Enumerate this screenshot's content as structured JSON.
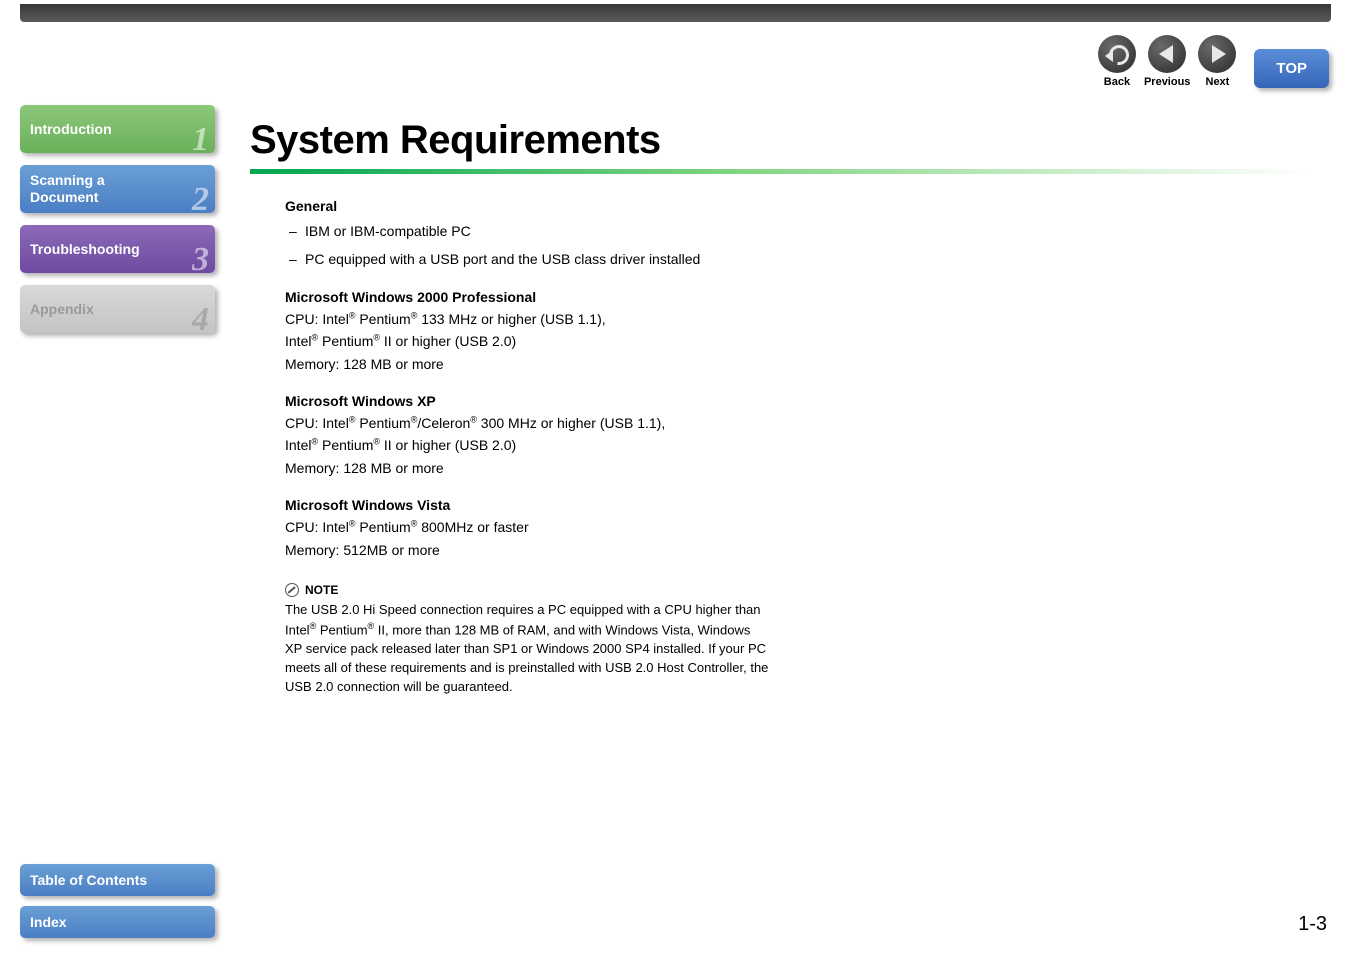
{
  "nav": {
    "back": "Back",
    "previous": "Previous",
    "next": "Next",
    "top": "TOP"
  },
  "tabs": [
    {
      "label": "Introduction",
      "number": "1"
    },
    {
      "label": "Scanning a\nDocument",
      "number": "2"
    },
    {
      "label": "Troubleshooting",
      "number": "3"
    },
    {
      "label": "Appendix",
      "number": "4"
    }
  ],
  "bottom_nav": {
    "toc": "Table of Contents",
    "index": "Index"
  },
  "page": {
    "title": "System Requirements",
    "general_heading": "General",
    "general_items": [
      "IBM or IBM-compatible PC",
      "PC equipped with a USB port and the USB class driver installed"
    ],
    "win2000": {
      "heading": "Microsoft Windows 2000 Professional",
      "cpu_a": "CPU: Intel",
      "cpu_b": " Pentium",
      "cpu_c": " 133 MHz or higher (USB 1.1),",
      "cpu2_a": "Intel",
      "cpu2_b": " Pentium",
      "cpu2_c": " II or higher (USB 2.0)",
      "memory": "Memory: 128 MB or more"
    },
    "winxp": {
      "heading": "Microsoft Windows XP",
      "cpu_a": "CPU: Intel",
      "cpu_b": " Pentium",
      "cpu_c": "/Celeron",
      "cpu_d": " 300 MHz or higher (USB 1.1),",
      "cpu2_a": "Intel",
      "cpu2_b": " Pentium",
      "cpu2_c": " II or higher (USB 2.0)",
      "memory": "Memory: 128 MB or more"
    },
    "winvista": {
      "heading": "Microsoft Windows Vista",
      "cpu_a": "CPU: Intel",
      "cpu_b": " Pentium",
      "cpu_c": " 800MHz or faster",
      "memory": "Memory: 512MB or more"
    },
    "note": {
      "label": "NOTE",
      "text_a": "The USB 2.0 Hi Speed connection requires a PC equipped with a CPU higher than Intel",
      "text_b": " Pentium",
      "text_c": " II, more than 128 MB of RAM, and with Windows Vista, Windows XP service pack released later than SP1 or Windows 2000 SP4 installed. If your PC meets all of these requirements and is preinstalled with USB 2.0 Host Controller, the USB 2.0 connection will be guaranteed."
    },
    "page_number": "1-3",
    "reg": "®"
  }
}
